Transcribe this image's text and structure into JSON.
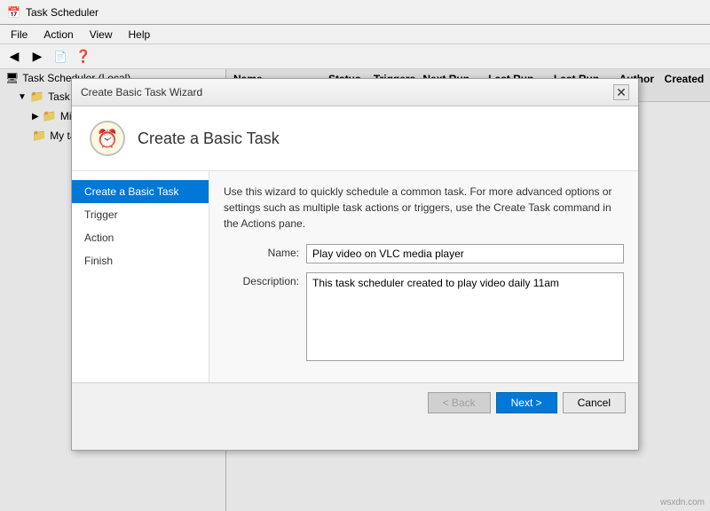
{
  "app": {
    "title": "Task Scheduler",
    "window_icon": "📅"
  },
  "menubar": {
    "items": [
      "File",
      "Action",
      "View",
      "Help"
    ]
  },
  "toolbar": {
    "buttons": [
      "◀",
      "▶",
      "✕",
      "?"
    ]
  },
  "left_panel": {
    "items": [
      {
        "label": "Task Scheduler (Local)",
        "level": 0,
        "icon": "computer"
      },
      {
        "label": "Task Scheduler Library",
        "level": 1,
        "icon": "folder"
      },
      {
        "label": "Microsoft",
        "level": 2,
        "icon": "folder"
      },
      {
        "label": "My tasks",
        "level": 2,
        "icon": "folder"
      }
    ]
  },
  "table": {
    "columns": [
      "Name",
      "Status",
      "Triggers",
      "Next Run Time",
      "Last Run Time",
      "Last Run Result",
      "Author",
      "Created"
    ]
  },
  "dialog": {
    "title": "Create Basic Task Wizard",
    "header_title": "Create a Basic Task",
    "description": "Use this wizard to quickly schedule a common task.  For more advanced options or settings such as multiple task actions or triggers, use the Create Task command in the Actions pane.",
    "steps": [
      {
        "label": "Create a Basic Task",
        "active": true
      },
      {
        "label": "Trigger"
      },
      {
        "label": "Action"
      },
      {
        "label": "Finish"
      }
    ],
    "form": {
      "name_label": "Name:",
      "name_value": "Play video on VLC media player",
      "description_label": "Description:",
      "description_value": "This task scheduler created to play video daily 11am"
    },
    "buttons": {
      "back": "< Back",
      "next": "Next >",
      "cancel": "Cancel"
    }
  },
  "watermark": "wsxdn.com"
}
